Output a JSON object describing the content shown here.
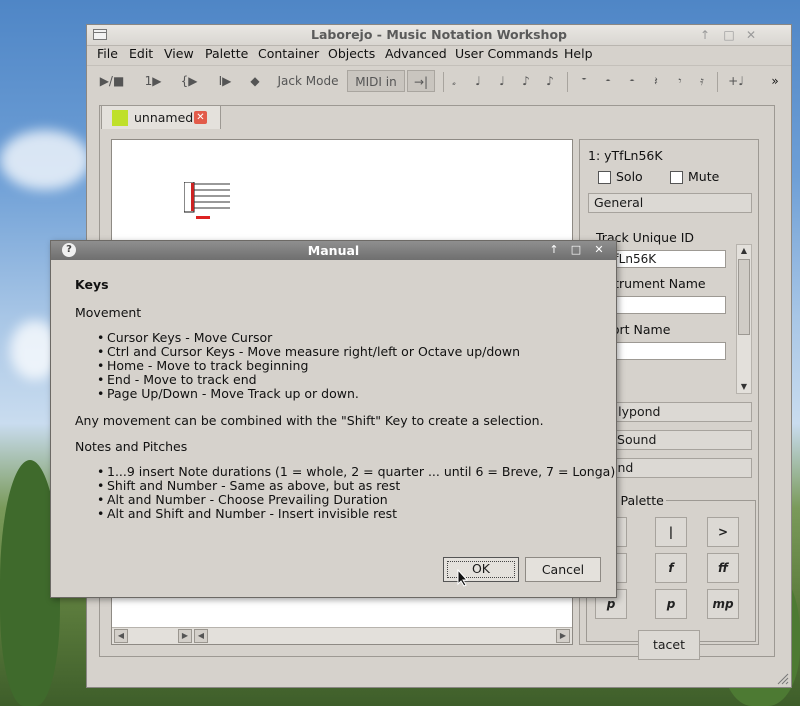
{
  "window": {
    "title": "Laborejo - Music Notation Workshop",
    "controls": [
      "↑",
      "□",
      "✕"
    ]
  },
  "menu": [
    "File",
    "Edit",
    "View",
    "Palette",
    "Container",
    "Objects",
    "Advanced",
    "User Commands",
    "Help"
  ],
  "toolbar": {
    "play": "▶/■",
    "b1": "1▶",
    "b2": "{▶",
    "b3": "I▶",
    "b4": "◆",
    "jack_mode": "Jack Mode",
    "midi_in": "MIDI in",
    "b5": "→|",
    "notes": [
      "𝅗",
      "♩",
      "♩",
      "♪",
      "♪"
    ],
    "rests": [
      "𝄻",
      "𝄼",
      "𝄼",
      "𝄽",
      "𝄾",
      "𝄿"
    ],
    "extra": "+♩",
    "more": "»"
  },
  "tab": {
    "label": "unnamed",
    "color": "#bfe02a"
  },
  "track_panel": {
    "header": "1: yTfLn56K",
    "solo": "Solo",
    "mute": "Mute",
    "general": "General",
    "track_unique_id_label": "Track Unique ID",
    "track_unique_id_value": "yTfLn56K",
    "instrument_name_label": "Instrument Name",
    "short_name_label": "Short Name",
    "lilypond_button": "& Lilypond",
    "internal_sound_button": "nal Sound",
    "sound_button": "Sound",
    "palette_title": "pad Palette",
    "palette_buttons": [
      ">",
      "|",
      ">",
      "f",
      "f",
      "ff",
      "p",
      "p",
      "mp"
    ],
    "tacet": "tacet"
  },
  "dialog": {
    "title": "Manual",
    "heading": "Keys",
    "section1": "Movement",
    "movement_items": [
      "Cursor Keys - Move Cursor",
      "Ctrl and Cursor Keys - Move measure right/left or Octave up/down",
      "Home - Move to track beginning",
      "End - Move to track end",
      "Page Up/Down - Move Track up or down."
    ],
    "selection_note": "Any movement can be combined with the \"Shift\" Key to create a selection.",
    "section2": "Notes and Pitches",
    "notes_items": [
      "1...9 insert Note durations (1 = whole, 2 = quarter ... until 6 = Breve, 7 = Longa)",
      "Shift and Number - Same as above, but as rest",
      "Alt and Number - Choose Prevailing Duration",
      "Alt and Shift and Number - Insert invisible rest"
    ],
    "ok": "OK",
    "cancel": "Cancel"
  },
  "watermark": "screenshots.debian.net"
}
